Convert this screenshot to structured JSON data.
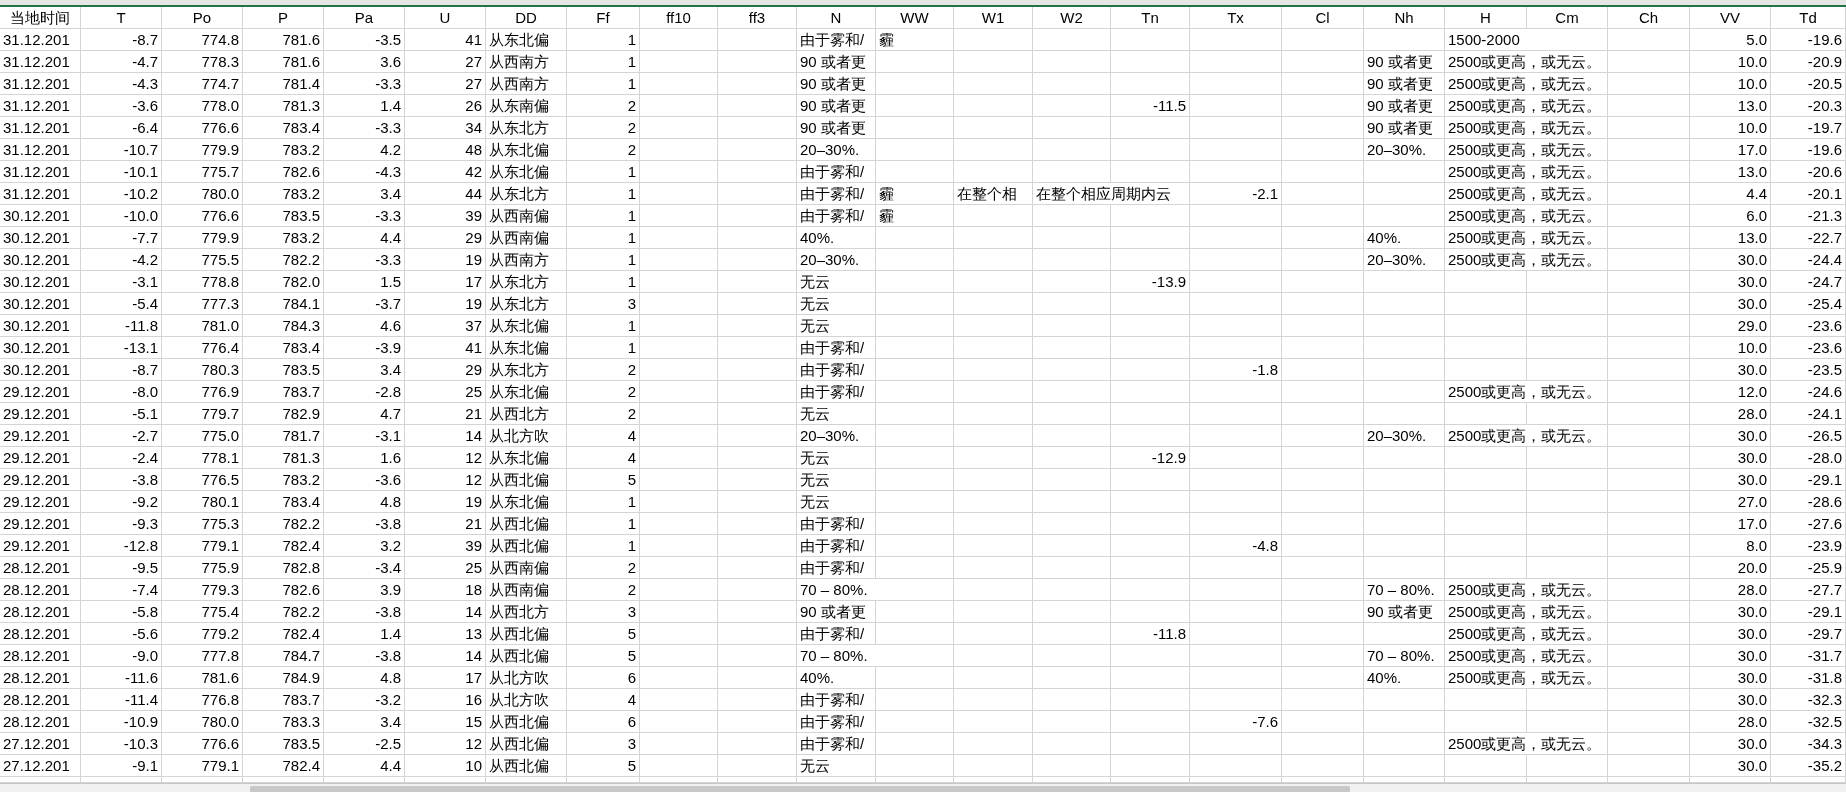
{
  "columns": [
    {
      "label": "当地时间",
      "kind": "text"
    },
    {
      "label": "T",
      "kind": "number"
    },
    {
      "label": "Po",
      "kind": "number"
    },
    {
      "label": "P",
      "kind": "number"
    },
    {
      "label": "Pa",
      "kind": "number"
    },
    {
      "label": "U",
      "kind": "number"
    },
    {
      "label": "DD",
      "kind": "text"
    },
    {
      "label": "Ff",
      "kind": "number"
    },
    {
      "label": "ff10"
    },
    {
      "label": "ff3"
    },
    {
      "label": "N",
      "kind": "text"
    },
    {
      "label": "WW",
      "kind": "text"
    },
    {
      "label": "W1",
      "kind": "text"
    },
    {
      "label": "W2",
      "kind": "text"
    },
    {
      "label": "Tn",
      "kind": "number"
    },
    {
      "label": "Tx",
      "kind": "number"
    },
    {
      "label": "Cl"
    },
    {
      "label": "Nh",
      "kind": "text"
    },
    {
      "label": "H",
      "kind": "text"
    },
    {
      "label": "Cm"
    },
    {
      "label": "Ch"
    },
    {
      "label": "VV",
      "kind": "number"
    },
    {
      "label": "Td",
      "kind": "number"
    }
  ],
  "rows": [
    [
      "31.12.201",
      "-8.7",
      "774.8",
      "781.6",
      "-3.5",
      "41",
      "从东北偏",
      "1",
      null,
      null,
      "由于雾和/",
      "霾",
      null,
      null,
      null,
      null,
      null,
      null,
      "1500-2000",
      null,
      null,
      "5.0",
      "-19.6"
    ],
    [
      "31.12.201",
      "-4.7",
      "778.3",
      "781.6",
      "3.6",
      "27",
      "从西南方",
      "1",
      null,
      null,
      "90 或者更",
      null,
      null,
      null,
      null,
      null,
      null,
      "90 或者更",
      "2500或更高，或无云。",
      null,
      null,
      "10.0",
      "-20.9"
    ],
    [
      "31.12.201",
      "-4.3",
      "774.7",
      "781.4",
      "-3.3",
      "27",
      "从西南方",
      "1",
      null,
      null,
      "90 或者更",
      null,
      null,
      null,
      null,
      null,
      null,
      "90 或者更",
      "2500或更高，或无云。",
      null,
      null,
      "10.0",
      "-20.5"
    ],
    [
      "31.12.201",
      "-3.6",
      "778.0",
      "781.3",
      "1.4",
      "26",
      "从东南偏",
      "2",
      null,
      null,
      "90 或者更",
      null,
      null,
      null,
      "-11.5",
      null,
      null,
      "90 或者更",
      "2500或更高，或无云。",
      null,
      null,
      "13.0",
      "-20.3"
    ],
    [
      "31.12.201",
      "-6.4",
      "776.6",
      "783.4",
      "-3.3",
      "34",
      "从东北方",
      "2",
      null,
      null,
      "90 或者更",
      null,
      null,
      null,
      null,
      null,
      null,
      "90 或者更",
      "2500或更高，或无云。",
      null,
      null,
      "10.0",
      "-19.7"
    ],
    [
      "31.12.201",
      "-10.7",
      "779.9",
      "783.2",
      "4.2",
      "48",
      "从东北偏",
      "2",
      null,
      null,
      "20–30%.",
      null,
      null,
      null,
      null,
      null,
      null,
      "20–30%.",
      "2500或更高，或无云。",
      null,
      null,
      "17.0",
      "-19.6"
    ],
    [
      "31.12.201",
      "-10.1",
      "775.7",
      "782.6",
      "-4.3",
      "42",
      "从东北偏",
      "1",
      null,
      null,
      "由于雾和/",
      null,
      null,
      null,
      null,
      null,
      null,
      null,
      "2500或更高，或无云。",
      null,
      null,
      "13.0",
      "-20.6"
    ],
    [
      "31.12.201",
      "-10.2",
      "780.0",
      "783.2",
      "3.4",
      "44",
      "从东北方",
      "1",
      null,
      null,
      "由于雾和/",
      "霾",
      "在整个相",
      "在整个相应周期内云",
      null,
      "-2.1",
      null,
      null,
      "2500或更高，或无云。",
      null,
      null,
      "4.4",
      "-20.1"
    ],
    [
      "30.12.201",
      "-10.0",
      "776.6",
      "783.5",
      "-3.3",
      "39",
      "从西南偏",
      "1",
      null,
      null,
      "由于雾和/",
      "霾",
      null,
      null,
      null,
      null,
      null,
      null,
      "2500或更高，或无云。",
      null,
      null,
      "6.0",
      "-21.3"
    ],
    [
      "30.12.201",
      "-7.7",
      "779.9",
      "783.2",
      "4.4",
      "29",
      "从西南偏",
      "1",
      null,
      null,
      "40%.",
      null,
      null,
      null,
      null,
      null,
      null,
      "40%.",
      "2500或更高，或无云。",
      null,
      null,
      "13.0",
      "-22.7"
    ],
    [
      "30.12.201",
      "-4.2",
      "775.5",
      "782.2",
      "-3.3",
      "19",
      "从西南方",
      "1",
      null,
      null,
      "20–30%.",
      null,
      null,
      null,
      null,
      null,
      null,
      "20–30%.",
      "2500或更高，或无云。",
      null,
      null,
      "30.0",
      "-24.4"
    ],
    [
      "30.12.201",
      "-3.1",
      "778.8",
      "782.0",
      "1.5",
      "17",
      "从东北方",
      "1",
      null,
      null,
      "无云",
      null,
      null,
      null,
      "-13.9",
      null,
      null,
      null,
      null,
      null,
      null,
      "30.0",
      "-24.7"
    ],
    [
      "30.12.201",
      "-5.4",
      "777.3",
      "784.1",
      "-3.7",
      "19",
      "从东北方",
      "3",
      null,
      null,
      "无云",
      null,
      null,
      null,
      null,
      null,
      null,
      null,
      null,
      null,
      null,
      "30.0",
      "-25.4"
    ],
    [
      "30.12.201",
      "-11.8",
      "781.0",
      "784.3",
      "4.6",
      "37",
      "从东北偏",
      "1",
      null,
      null,
      "无云",
      null,
      null,
      null,
      null,
      null,
      null,
      null,
      null,
      null,
      null,
      "29.0",
      "-23.6"
    ],
    [
      "30.12.201",
      "-13.1",
      "776.4",
      "783.4",
      "-3.9",
      "41",
      "从东北偏",
      "1",
      null,
      null,
      "由于雾和/",
      null,
      null,
      null,
      null,
      null,
      null,
      null,
      null,
      null,
      null,
      "10.0",
      "-23.6"
    ],
    [
      "30.12.201",
      "-8.7",
      "780.3",
      "783.5",
      "3.4",
      "29",
      "从东北方",
      "2",
      null,
      null,
      "由于雾和/",
      null,
      null,
      null,
      null,
      "-1.8",
      null,
      null,
      null,
      null,
      null,
      "30.0",
      "-23.5"
    ],
    [
      "29.12.201",
      "-8.0",
      "776.9",
      "783.7",
      "-2.8",
      "25",
      "从东北偏",
      "2",
      null,
      null,
      "由于雾和/",
      null,
      null,
      null,
      null,
      null,
      null,
      null,
      "2500或更高，或无云。",
      null,
      null,
      "12.0",
      "-24.6"
    ],
    [
      "29.12.201",
      "-5.1",
      "779.7",
      "782.9",
      "4.7",
      "21",
      "从西北方",
      "2",
      null,
      null,
      "无云",
      null,
      null,
      null,
      null,
      null,
      null,
      null,
      null,
      null,
      null,
      "28.0",
      "-24.1"
    ],
    [
      "29.12.201",
      "-2.7",
      "775.0",
      "781.7",
      "-3.1",
      "14",
      "从北方吹",
      "4",
      null,
      null,
      "20–30%.",
      null,
      null,
      null,
      null,
      null,
      null,
      "20–30%.",
      "2500或更高，或无云。",
      null,
      null,
      "30.0",
      "-26.5"
    ],
    [
      "29.12.201",
      "-2.4",
      "778.1",
      "781.3",
      "1.6",
      "12",
      "从东北偏",
      "4",
      null,
      null,
      "无云",
      null,
      null,
      null,
      "-12.9",
      null,
      null,
      null,
      null,
      null,
      null,
      "30.0",
      "-28.0"
    ],
    [
      "29.12.201",
      "-3.8",
      "776.5",
      "783.2",
      "-3.6",
      "12",
      "从西北偏",
      "5",
      null,
      null,
      "无云",
      null,
      null,
      null,
      null,
      null,
      null,
      null,
      null,
      null,
      null,
      "30.0",
      "-29.1"
    ],
    [
      "29.12.201",
      "-9.2",
      "780.1",
      "783.4",
      "4.8",
      "19",
      "从东北偏",
      "1",
      null,
      null,
      "无云",
      null,
      null,
      null,
      null,
      null,
      null,
      null,
      null,
      null,
      null,
      "27.0",
      "-28.6"
    ],
    [
      "29.12.201",
      "-9.3",
      "775.3",
      "782.2",
      "-3.8",
      "21",
      "从西北偏",
      "1",
      null,
      null,
      "由于雾和/",
      null,
      null,
      null,
      null,
      null,
      null,
      null,
      null,
      null,
      null,
      "17.0",
      "-27.6"
    ],
    [
      "29.12.201",
      "-12.8",
      "779.1",
      "782.4",
      "3.2",
      "39",
      "从西北偏",
      "1",
      null,
      null,
      "由于雾和/",
      null,
      null,
      null,
      null,
      "-4.8",
      null,
      null,
      null,
      null,
      null,
      "8.0",
      "-23.9"
    ],
    [
      "28.12.201",
      "-9.5",
      "775.9",
      "782.8",
      "-3.4",
      "25",
      "从西南偏",
      "2",
      null,
      null,
      "由于雾和/",
      null,
      null,
      null,
      null,
      null,
      null,
      null,
      null,
      null,
      null,
      "20.0",
      "-25.9"
    ],
    [
      "28.12.201",
      "-7.4",
      "779.3",
      "782.6",
      "3.9",
      "18",
      "从西南偏",
      "2",
      null,
      null,
      "70 – 80%.",
      null,
      null,
      null,
      null,
      null,
      null,
      "70 – 80%.",
      "2500或更高，或无云。",
      null,
      null,
      "28.0",
      "-27.7"
    ],
    [
      "28.12.201",
      "-5.8",
      "775.4",
      "782.2",
      "-3.8",
      "14",
      "从西北方",
      "3",
      null,
      null,
      "90 或者更",
      null,
      null,
      null,
      null,
      null,
      null,
      "90 或者更",
      "2500或更高，或无云。",
      null,
      null,
      "30.0",
      "-29.1"
    ],
    [
      "28.12.201",
      "-5.6",
      "779.2",
      "782.4",
      "1.4",
      "13",
      "从西北偏",
      "5",
      null,
      null,
      "由于雾和/",
      null,
      null,
      null,
      "-11.8",
      null,
      null,
      null,
      "2500或更高，或无云。",
      null,
      null,
      "30.0",
      "-29.7"
    ],
    [
      "28.12.201",
      "-9.0",
      "777.8",
      "784.7",
      "-3.8",
      "14",
      "从西北偏",
      "5",
      null,
      null,
      "70 – 80%.",
      null,
      null,
      null,
      null,
      null,
      null,
      "70 – 80%.",
      "2500或更高，或无云。",
      null,
      null,
      "30.0",
      "-31.7"
    ],
    [
      "28.12.201",
      "-11.6",
      "781.6",
      "784.9",
      "4.8",
      "17",
      "从北方吹",
      "6",
      null,
      null,
      "40%.",
      null,
      null,
      null,
      null,
      null,
      null,
      "40%.",
      "2500或更高，或无云。",
      null,
      null,
      "30.0",
      "-31.8"
    ],
    [
      "28.12.201",
      "-11.4",
      "776.8",
      "783.7",
      "-3.2",
      "16",
      "从北方吹",
      "4",
      null,
      null,
      "由于雾和/",
      null,
      null,
      null,
      null,
      null,
      null,
      null,
      null,
      null,
      null,
      "30.0",
      "-32.3"
    ],
    [
      "28.12.201",
      "-10.9",
      "780.0",
      "783.3",
      "3.4",
      "15",
      "从西北偏",
      "6",
      null,
      null,
      "由于雾和/",
      null,
      null,
      null,
      null,
      "-7.6",
      null,
      null,
      null,
      null,
      null,
      "28.0",
      "-32.5"
    ],
    [
      "27.12.201",
      "-10.3",
      "776.6",
      "783.5",
      "-2.5",
      "12",
      "从西北偏",
      "3",
      null,
      null,
      "由于雾和/",
      null,
      null,
      null,
      null,
      null,
      null,
      null,
      "2500或更高，或无云。",
      null,
      null,
      "30.0",
      "-34.3"
    ],
    [
      "27.12.201",
      "-9.1",
      "779.1",
      "782.4",
      "4.4",
      "10",
      "从西北偏",
      "5",
      null,
      null,
      "无云",
      null,
      null,
      null,
      null,
      null,
      null,
      null,
      null,
      null,
      null,
      "30.0",
      "-35.2"
    ]
  ]
}
